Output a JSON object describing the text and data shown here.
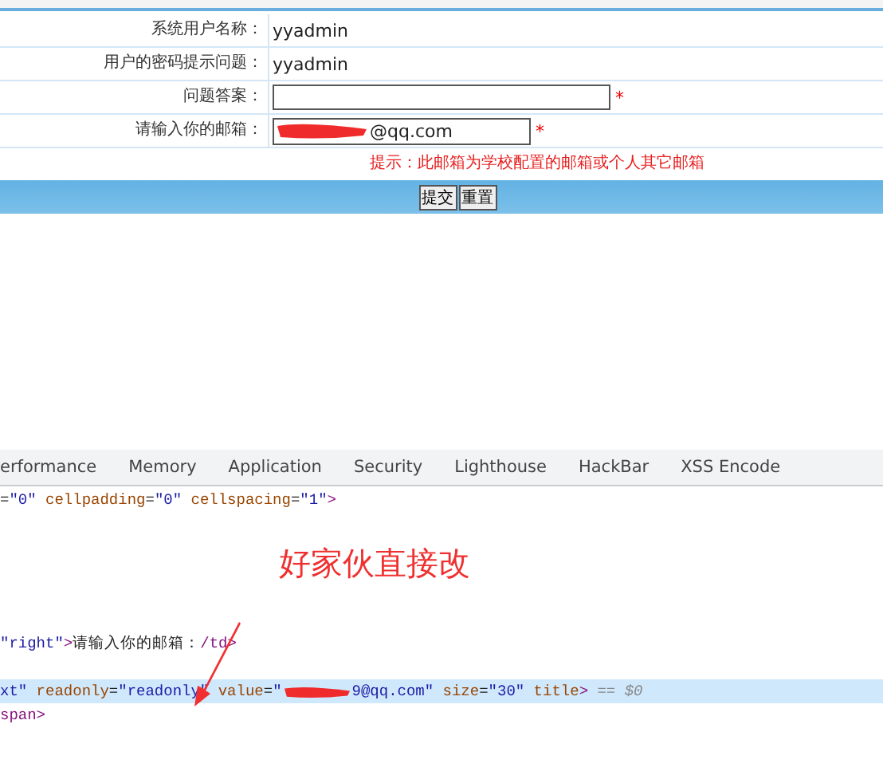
{
  "form": {
    "rows": [
      {
        "label": "系统用户名称：",
        "kind": "text",
        "value": "yyadmin"
      },
      {
        "label": "用户的密码提示问题：",
        "kind": "text",
        "value": "yyadmin"
      },
      {
        "label": "问题答案：",
        "kind": "input",
        "value": "",
        "required": "*"
      },
      {
        "label": "请输入你的邮箱：",
        "kind": "redacted-input",
        "value": "@qq.com",
        "required": "*"
      }
    ],
    "hint": "提示：此邮箱为学校配置的邮箱或个人其它邮箱",
    "buttons": [
      "提交",
      "重置"
    ]
  },
  "devtools": {
    "tabs": [
      {
        "label": "erformance",
        "selected": false
      },
      {
        "label": "Memory",
        "selected": false
      },
      {
        "label": "Application",
        "selected": false
      },
      {
        "label": "Security",
        "selected": false
      },
      {
        "label": "Lighthouse",
        "selected": false
      },
      {
        "label": "HackBar",
        "selected": false
      },
      {
        "label": "XSS Encode",
        "selected": false
      }
    ],
    "lines": [
      {
        "highlighted": false,
        "tokens": [
          {
            "kind": "plain",
            "text": "="
          },
          {
            "kind": "val",
            "text": "\"0\""
          },
          {
            "kind": "attr",
            "text": " cellpadding"
          },
          {
            "kind": "plain",
            "text": "="
          },
          {
            "kind": "val",
            "text": "\"0\""
          },
          {
            "kind": "attr",
            "text": " cellspacing"
          },
          {
            "kind": "plain",
            "text": "="
          },
          {
            "kind": "val",
            "text": "\"1\""
          },
          {
            "kind": "tag",
            "text": ">"
          }
        ]
      },
      {
        "highlighted": false,
        "tokens": [
          {
            "kind": "val",
            "text": "\"right\""
          },
          {
            "kind": "tag",
            "text": ">"
          },
          {
            "kind": "plain",
            "text": "请输入你的邮箱："
          },
          {
            "kind": "tag",
            "text": "/td>"
          }
        ]
      },
      {
        "highlighted": true,
        "tokens": [
          {
            "kind": "val",
            "text": "xt\""
          },
          {
            "kind": "attr",
            "text": " readonly"
          },
          {
            "kind": "plain",
            "text": "="
          },
          {
            "kind": "val",
            "text": "\"readonly\""
          },
          {
            "kind": "attr",
            "text": " value"
          },
          {
            "kind": "plain",
            "text": "="
          },
          {
            "kind": "val",
            "text": "\""
          },
          {
            "kind": "redaction"
          },
          {
            "kind": "val",
            "text": "9@qq.com\""
          },
          {
            "kind": "attr",
            "text": " size"
          },
          {
            "kind": "plain",
            "text": "="
          },
          {
            "kind": "val",
            "text": "\"30\""
          },
          {
            "kind": "attr",
            "text": " title"
          },
          {
            "kind": "tag",
            "text": ">"
          },
          {
            "kind": "hint",
            "text": " == $0"
          }
        ]
      },
      {
        "highlighted": false,
        "tokens": [
          {
            "kind": "tag",
            "text": "span>"
          }
        ]
      }
    ]
  },
  "annotation": {
    "text": "好家伙直接改"
  }
}
